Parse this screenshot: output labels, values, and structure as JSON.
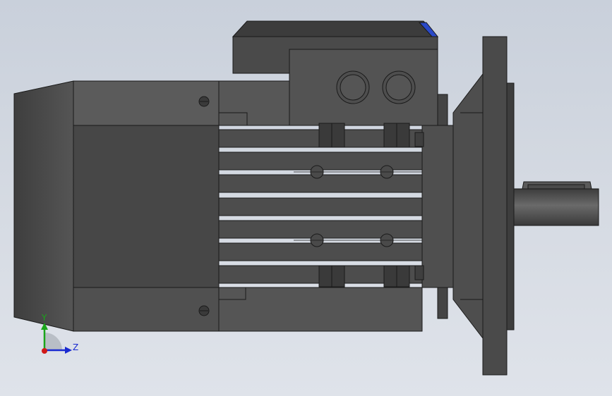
{
  "triad": {
    "y_label": "Y",
    "z_label": "Z",
    "y_color": "#1aa51a",
    "z_color": "#1a2ad0",
    "x_color": "#d01818"
  },
  "colors": {
    "body": "#4a4a4a",
    "body_light": "#5a5a5a",
    "edge": "#1a1a1a",
    "accent_blue": "#3050c8"
  },
  "model": {
    "name": "",
    "parts": [
      "fan-cover",
      "motor-housing",
      "terminal-box",
      "cooling-fins",
      "end-shield",
      "flange",
      "output-shaft",
      "key"
    ]
  }
}
